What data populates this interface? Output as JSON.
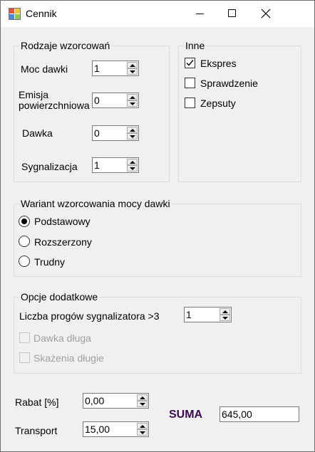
{
  "window": {
    "title": "Cennik"
  },
  "types_group": {
    "title": "Rodzaje wzorcowań",
    "dose_rate": {
      "label": "Moc dawki",
      "value": "1"
    },
    "surface_emission": {
      "label_line1": "Emisja",
      "label_line2": "powierzchniowa",
      "value": "0"
    },
    "dose": {
      "label": "Dawka",
      "value": "0"
    },
    "signaling": {
      "label": "Sygnalizacja",
      "value": "1"
    }
  },
  "other_group": {
    "title": "Inne",
    "express": {
      "label": "Ekspres",
      "checked": true
    },
    "check": {
      "label": "Sprawdzenie",
      "checked": false
    },
    "broken": {
      "label": "Zepsuty",
      "checked": false
    }
  },
  "variant_group": {
    "title": "Wariant wzorcowania mocy dawki",
    "options": [
      {
        "label": "Podstawowy",
        "selected": true
      },
      {
        "label": "Rozszerzony",
        "selected": false
      },
      {
        "label": "Trudny",
        "selected": false
      }
    ]
  },
  "extra_group": {
    "title": "Opcje dodatkowe",
    "thresholds": {
      "label": "Liczba progów sygnalizatora >3",
      "value": "1"
    },
    "long_dose": {
      "label": "Dawka długa",
      "checked": false,
      "enabled": false
    },
    "long_contamination": {
      "label": "Skażenia długie",
      "checked": false,
      "enabled": false
    }
  },
  "discount": {
    "label": "Rabat [%]",
    "value": "0,00"
  },
  "transport": {
    "label": "Transport",
    "value": "15,00"
  },
  "total": {
    "label": "SUMA",
    "value": "645,00",
    "color": "#3b0a4f"
  }
}
